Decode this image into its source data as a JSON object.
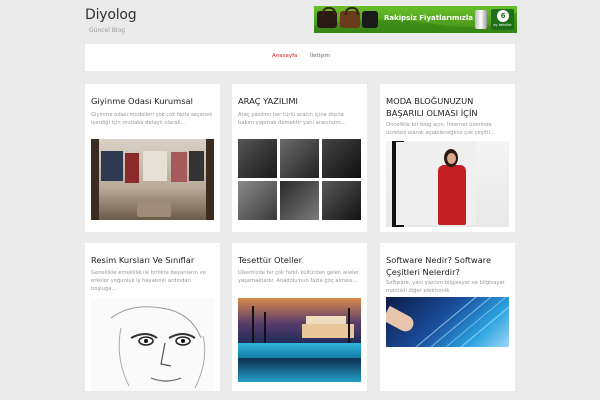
{
  "site": {
    "title": "Diyolog",
    "tagline": "Güncel Blog"
  },
  "banner": {
    "text": "Rakipsiz Fiyatlarımızla",
    "badge_number": "6",
    "badge_text": "ay taksitle"
  },
  "nav": {
    "items": [
      {
        "label": "Anasayfa",
        "active": true
      },
      {
        "label": "İletişim",
        "active": false
      }
    ]
  },
  "posts": [
    {
      "title": "Giyinme Odası Kurumsal",
      "excerpt": "Giyinme odası modelleri çok çok fazla seçenek içerdiği için mutlaka detaylı olarak...",
      "image": "walk-in-closet-photo"
    },
    {
      "title": "ARAÇ YAZILIMI",
      "excerpt": "Araç yazılımı her türlü aracın içine dışına bakım yapmak demektir yani aracınızın...",
      "image": "car-collage-photo"
    },
    {
      "title": "MODA BLOĞUNUZUN BAŞARILI OLMASI İÇİN",
      "excerpt": "Öncelikle bir blog açın. İnternet üzerinde ücretsiz olarak açabileceğiniz çok çeşitli...",
      "image": "fashion-model-photo"
    },
    {
      "title": "Resim Kursları Ve Sınıflar",
      "excerpt": "Genellikle emeklilik ile birlikte bayanların ve erkeler yoğunluk iş hayatının ardından boşluğa...",
      "image": "pencil-sketch-portrait"
    },
    {
      "title": "Tesettür Oteller",
      "excerpt": "Ülkemizde bir çok farklı kültürden gelen aileler yaşamaktadır. Anadolu'nun fazla göç alması...",
      "image": "hotel-pool-photo"
    },
    {
      "title": "Software Nedir? Software Çeşitleri Nelerdir?",
      "excerpt": "Software, yani yazılım bilgisayar ve bilgisayar mantıklı diğer elektronik",
      "image": "software-touch-photo"
    }
  ],
  "colors": {
    "accent": "#d9232a",
    "background": "#ebebeb",
    "card": "#ffffff",
    "banner_green": "#4fa51f"
  }
}
